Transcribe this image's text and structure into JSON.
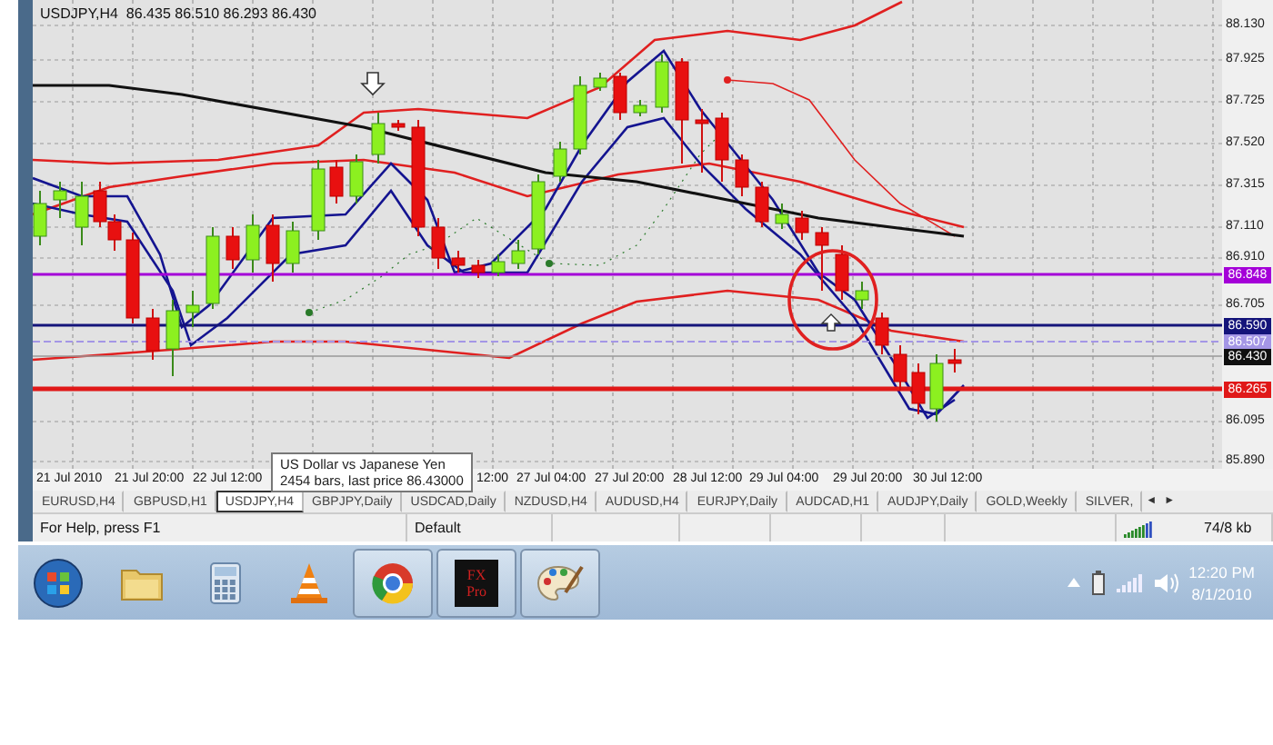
{
  "chart": {
    "title": "USDJPY,H4  86.435 86.510 86.293 86.430",
    "price_ticks": [
      "88.130",
      "87.925",
      "87.725",
      "87.520",
      "87.315",
      "87.110",
      "86.910",
      "86.705",
      "86.095",
      "85.890"
    ],
    "price_tags": [
      {
        "label": "86.848",
        "color": "#a400d8"
      },
      {
        "label": "86.590",
        "color": "#14147a"
      },
      {
        "label": "86.507",
        "color": "#a496e6"
      },
      {
        "label": "86.430",
        "color": "#101010"
      },
      {
        "label": "86.265",
        "color": "#e01818"
      }
    ],
    "time_labels": [
      "21 Jul 2010",
      "21 Jul 20:00",
      "22 Jul 12:00",
      "12:00",
      "27 Jul 04:00",
      "27 Jul 20:00",
      "28 Jul 12:00",
      "29 Jul 04:00",
      "29 Jul 20:00",
      "30 Jul 12:00"
    ],
    "tooltip": {
      "title": "US Dollar vs Japanese Yen",
      "detail": "2454 bars, last price 86.43000"
    }
  },
  "tabs": [
    {
      "label": "EURUSD,H4",
      "selected": false
    },
    {
      "label": "GBPUSD,H1",
      "selected": false
    },
    {
      "label": "USDJPY,H4",
      "selected": true
    },
    {
      "label": "GBPJPY,Daily",
      "selected": false
    },
    {
      "label": "USDCAD,Daily",
      "selected": false
    },
    {
      "label": "NZDUSD,H4",
      "selected": false
    },
    {
      "label": "AUDUSD,H4",
      "selected": false
    },
    {
      "label": "EURJPY,Daily",
      "selected": false
    },
    {
      "label": "AUDCAD,H1",
      "selected": false
    },
    {
      "label": "AUDJPY,Daily",
      "selected": false
    },
    {
      "label": "GOLD,Weekly",
      "selected": false
    },
    {
      "label": "SILVER,",
      "selected": false
    }
  ],
  "tab_scroll": [
    "◄",
    "►"
  ],
  "status_bar": {
    "help": "For Help, press F1",
    "profile": "Default",
    "traffic": "74/8 kb"
  },
  "taskbar": {
    "apps": [
      {
        "kind": "folder",
        "active": false
      },
      {
        "kind": "calculator",
        "active": false
      },
      {
        "kind": "cone",
        "active": false
      },
      {
        "kind": "browser",
        "active": true
      },
      {
        "kind": "fx",
        "active": true,
        "lines": [
          "FX",
          "Pro"
        ]
      },
      {
        "kind": "palette",
        "active": true
      }
    ],
    "clock": {
      "time": "12:20 PM",
      "date": "8/1/2010"
    }
  }
}
